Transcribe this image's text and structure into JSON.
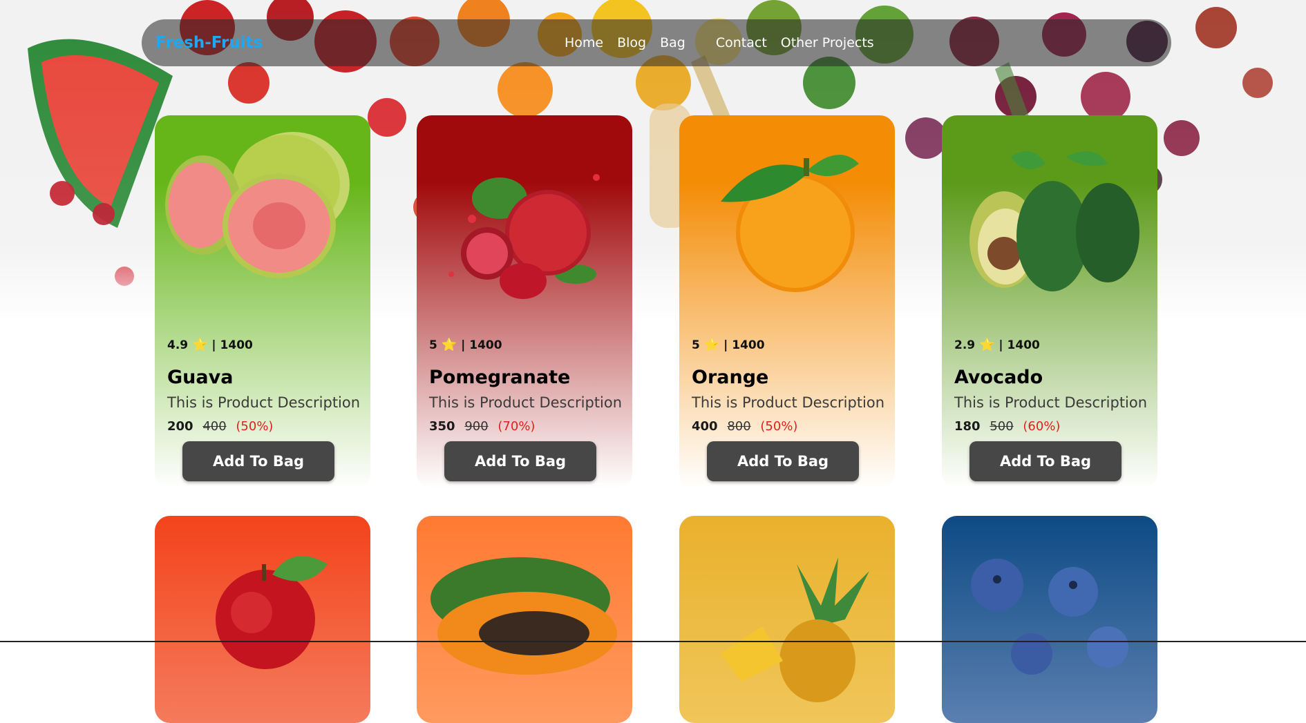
{
  "nav": {
    "brand": "Fresh-Fruits",
    "links": [
      "Home",
      "Blog",
      "Bag",
      "Contact",
      "Other Projects"
    ]
  },
  "products": [
    {
      "name": "Guava",
      "rating": "4.9",
      "count": "1400",
      "desc": "This is Product Description",
      "price": "200",
      "old": "400",
      "off": "(50%)",
      "button": "Add To Bag",
      "top": "#66b61a",
      "bottom": "#ffffff",
      "icon": "guava-image"
    },
    {
      "name": "Pomegranate",
      "rating": "5",
      "count": "1400",
      "desc": "This is Product Description",
      "price": "350",
      "old": "900",
      "off": "(70%)",
      "button": "Add To Bag",
      "top": "#a10a0c",
      "bottom": "#ffffff",
      "icon": "pomegranate-image"
    },
    {
      "name": "Orange",
      "rating": "5",
      "count": "1400",
      "desc": "This is Product Description",
      "price": "400",
      "old": "800",
      "off": "(50%)",
      "button": "Add To Bag",
      "top": "#f48c06",
      "bottom": "#ffffff",
      "icon": "orange-image"
    },
    {
      "name": "Avocado",
      "rating": "2.9",
      "count": "1400",
      "desc": "This is Product Description",
      "price": "180",
      "old": "500",
      "off": "(60%)",
      "button": "Add To Bag",
      "top": "#5c9a1a",
      "bottom": "#ffffff",
      "icon": "avocado-image"
    }
  ],
  "products_row2": [
    {
      "icon": "apple-image",
      "top": "#f3431b",
      "bottom": "#f47b5c"
    },
    {
      "icon": "papaya-image",
      "top": "#ff7a33",
      "bottom": "#ff9a5e"
    },
    {
      "icon": "pineapple-image",
      "top": "#e9b12c",
      "bottom": "#f0c65a"
    },
    {
      "icon": "blueberry-image",
      "top": "#0d4b84",
      "bottom": "#5b7fb0"
    }
  ],
  "ui": {
    "star": "⭐",
    "separator": "|"
  }
}
